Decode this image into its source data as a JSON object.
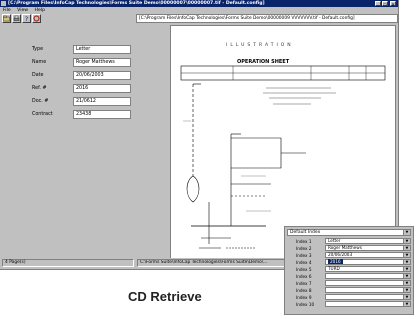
{
  "window": {
    "title": "[C:\\Program Files\\InfoCap Technologies\\Forms Suite Demo\\00000007\\00000007.tif - Default.config]",
    "menus": [
      "File",
      "View",
      "Help"
    ],
    "path": "[C:\\Program Files\\InfoCap Technologies\\Forms Suite Demo\\00000009 VVVVVVV.tif - Default.config]"
  },
  "form": {
    "fields": [
      {
        "label": "Type",
        "value": "Letter"
      },
      {
        "label": "Name",
        "value": "Roger Matthews"
      },
      {
        "label": "Date",
        "value": "20/06/2003"
      },
      {
        "label": "Ref. #",
        "value": "2016"
      },
      {
        "label": "Doc. #",
        "value": "21/0612"
      },
      {
        "label": "Contract",
        "value": "23438"
      }
    ]
  },
  "document": {
    "header": "ILLUSTRATION",
    "subtitle": "OPERATION SHEET"
  },
  "statusbar": {
    "left": "4 Page(s)",
    "right": "C:\\Forms Suite\\InfoCap Technologies\\Forms Suite\\Demo\\..."
  },
  "index_panel": {
    "profile": "Default Index",
    "rows": [
      {
        "label": "Index 1",
        "value": "Letter"
      },
      {
        "label": "Index 2",
        "value": "Roger Matthews"
      },
      {
        "label": "Index 3",
        "value": "20/06/2003"
      },
      {
        "label": "Index 4",
        "value": "2016"
      },
      {
        "label": "Index 5",
        "value": "TURD"
      },
      {
        "label": "Index 6",
        "value": ""
      },
      {
        "label": "Index 7",
        "value": ""
      },
      {
        "label": "Index 8",
        "value": ""
      },
      {
        "label": "Index 9",
        "value": ""
      },
      {
        "label": "Index 10",
        "value": ""
      }
    ]
  },
  "caption": "CD Retrieve"
}
